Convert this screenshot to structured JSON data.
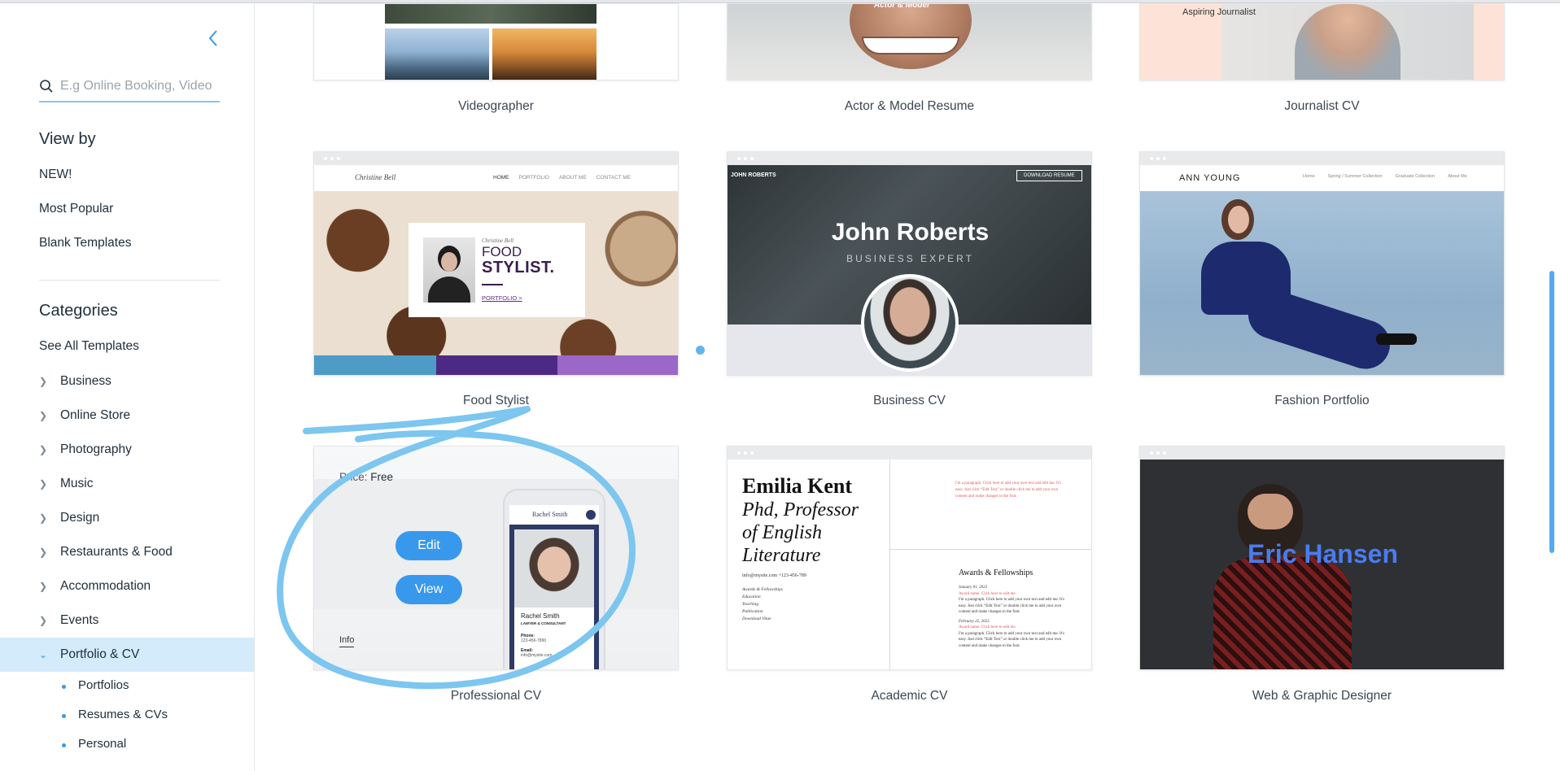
{
  "sidebar": {
    "search_placeholder": "E.g Online Booking, Video",
    "view_by_heading": "View by",
    "view_by": [
      "NEW!",
      "Most Popular",
      "Blank Templates"
    ],
    "categories_heading": "Categories",
    "see_all": "See All Templates",
    "categories": [
      "Business",
      "Online Store",
      "Photography",
      "Music",
      "Design",
      "Restaurants & Food",
      "Accommodation",
      "Events",
      "Portfolio & CV"
    ],
    "active_category": "Portfolio & CV",
    "subcategories": [
      "Portfolios",
      "Resumes & CVs",
      "Personal"
    ]
  },
  "templates": {
    "row1": [
      "Videographer",
      "Actor & Model Resume",
      "Journalist CV"
    ],
    "row2": [
      "Food Stylist",
      "Business CV",
      "Fashion Portfolio"
    ],
    "row3": [
      "Professional CV",
      "Academic CV",
      "Web & Graphic Designer"
    ]
  },
  "previews": {
    "journalist_tag": "Aspiring Journalist",
    "actor_tag": "Actor & Model",
    "food": {
      "brand": "Christine Bell",
      "nav": [
        "HOME",
        "PORTFOLIO",
        "ABOUT ME",
        "CONTACT ME"
      ],
      "small": "Christine Bell",
      "line1": "FOOD",
      "line2": "STYLIST.",
      "link": "PORTFOLIO >"
    },
    "business": {
      "brand": "JOHN ROBERTS",
      "button": "DOWNLOAD RESUME",
      "name": "John Roberts",
      "title": "BUSINESS EXPERT"
    },
    "fashion": {
      "brand": "ANN YOUNG",
      "nav": [
        "Home",
        "Spring / Summer Collection",
        "Graduate Collection",
        "About Me"
      ]
    },
    "academic": {
      "name": "Emilia Kent",
      "title_lines": [
        "Phd, Professor",
        "of English",
        "Literature"
      ],
      "contact": "info@mysite.com   +123-456-789",
      "list": [
        "Awards & Fellowships",
        "Education",
        "Teaching",
        "Publication",
        "Download Vitae"
      ],
      "section": "Awards & Fellowships",
      "date1": "January 01, 2023",
      "date2": "February 22, 2023",
      "award": "Award name. Click here to edit me.",
      "para": "I'm a paragraph. Click here to add your own text and edit me. It's easy. Just click “Edit Text” or double click me to add your own content and make changes to the font."
    },
    "designer": {
      "name": "Eric Hansen"
    },
    "professional": {
      "price_label": "Price:",
      "price_value": "Free",
      "edit": "Edit",
      "view": "View",
      "info": "Info",
      "brand": "Rachel Smith",
      "name": "Rachel Smith",
      "role": "LAWYER & CONSULTANT",
      "phone_label": "Phone:",
      "phone": "123-456-7890",
      "email_label": "Email:",
      "email": "info@mysite.com"
    }
  }
}
